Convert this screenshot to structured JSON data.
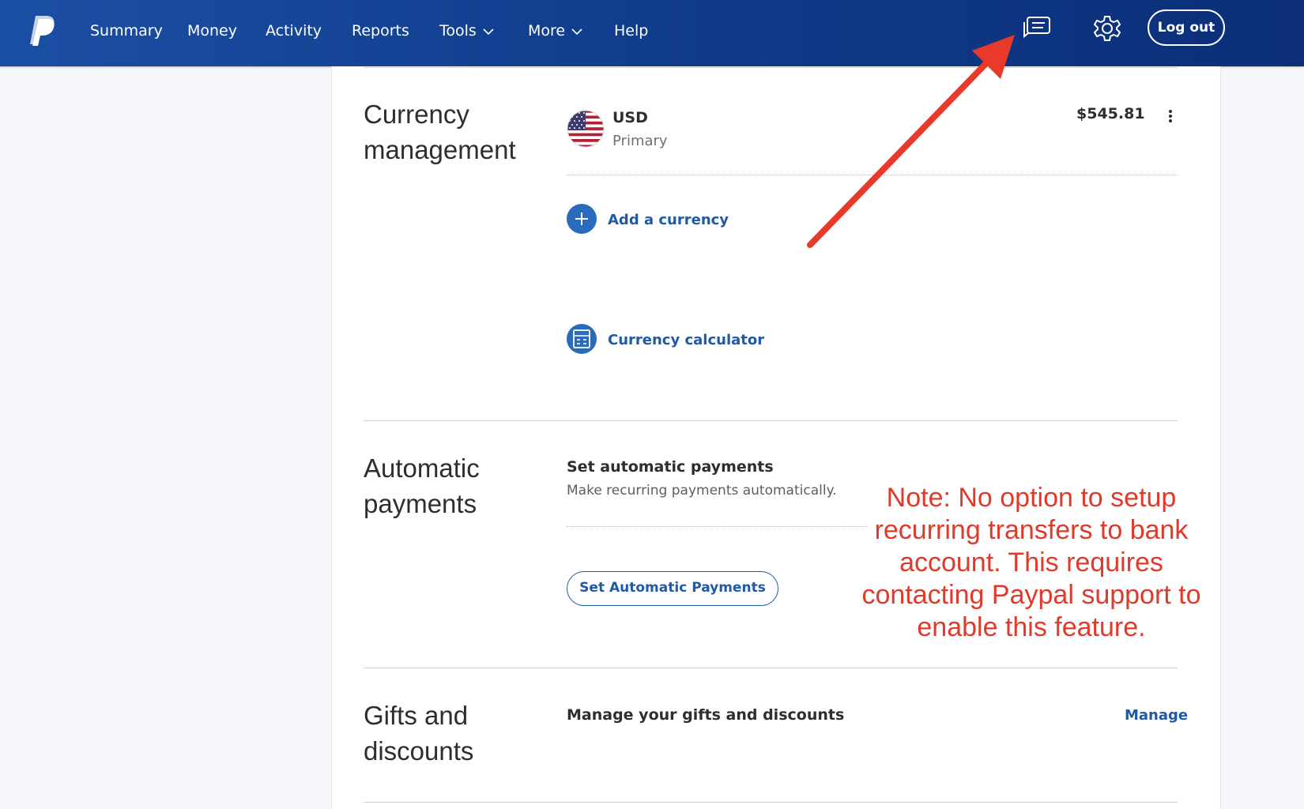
{
  "nav": {
    "items": [
      "Summary",
      "Money",
      "Activity",
      "Reports",
      "Tools",
      "More",
      "Help"
    ],
    "logout_label": "Log out",
    "logo_icon": "paypal-logo",
    "message_icon": "message-center-icon",
    "settings_icon": "gear-icon"
  },
  "currency": {
    "title": "Currency management",
    "code": "USD",
    "status": "Primary",
    "balance": "$545.81",
    "add_label": "Add a currency",
    "calculator_label": "Currency calculator"
  },
  "automatic": {
    "title": "Automatic payments",
    "heading": "Set automatic payments",
    "description": "Make recurring payments automatically.",
    "button_label": "Set Automatic Payments"
  },
  "gifts": {
    "title": "Gifts and discounts",
    "heading": "Manage your gifts and discounts",
    "manage_label": "Manage"
  },
  "annotation": {
    "note": "Note: No option to setup recurring transfers to bank account. This requires contacting Paypal support to enable this feature.",
    "color": "#e03a2a"
  },
  "colors": {
    "nav_bg": "#1b4fa3",
    "link": "#1f5aa6",
    "icon_circle": "#2a6bbd"
  }
}
